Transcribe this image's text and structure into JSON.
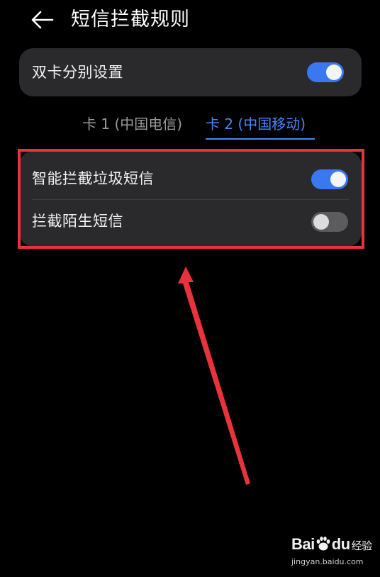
{
  "header": {
    "title": "短信拦截规则",
    "back_icon": "arrow-left-icon"
  },
  "dual_card": {
    "label": "双卡分别设置",
    "toggle_on": true
  },
  "tabs": [
    {
      "label": "卡 1 (中国电信)",
      "selected": false
    },
    {
      "label": "卡 2 (中国移动)",
      "selected": true
    }
  ],
  "rules": [
    {
      "label": "智能拦截垃圾短信",
      "toggle_on": true
    },
    {
      "label": "拦截陌生短信",
      "toggle_on": false
    }
  ],
  "annotation": {
    "box_color": "#e8333a",
    "arrow_color": "#e8333a"
  },
  "watermark": {
    "logo_prefix": "Bai",
    "logo_middle": "du",
    "logo_suffix": "经验",
    "url": "jingyan.baidu.com"
  },
  "colors": {
    "accent": "#3a78f0",
    "tab_active": "#4a86f4",
    "card_bg": "#2a2a2c",
    "background": "#000000"
  }
}
